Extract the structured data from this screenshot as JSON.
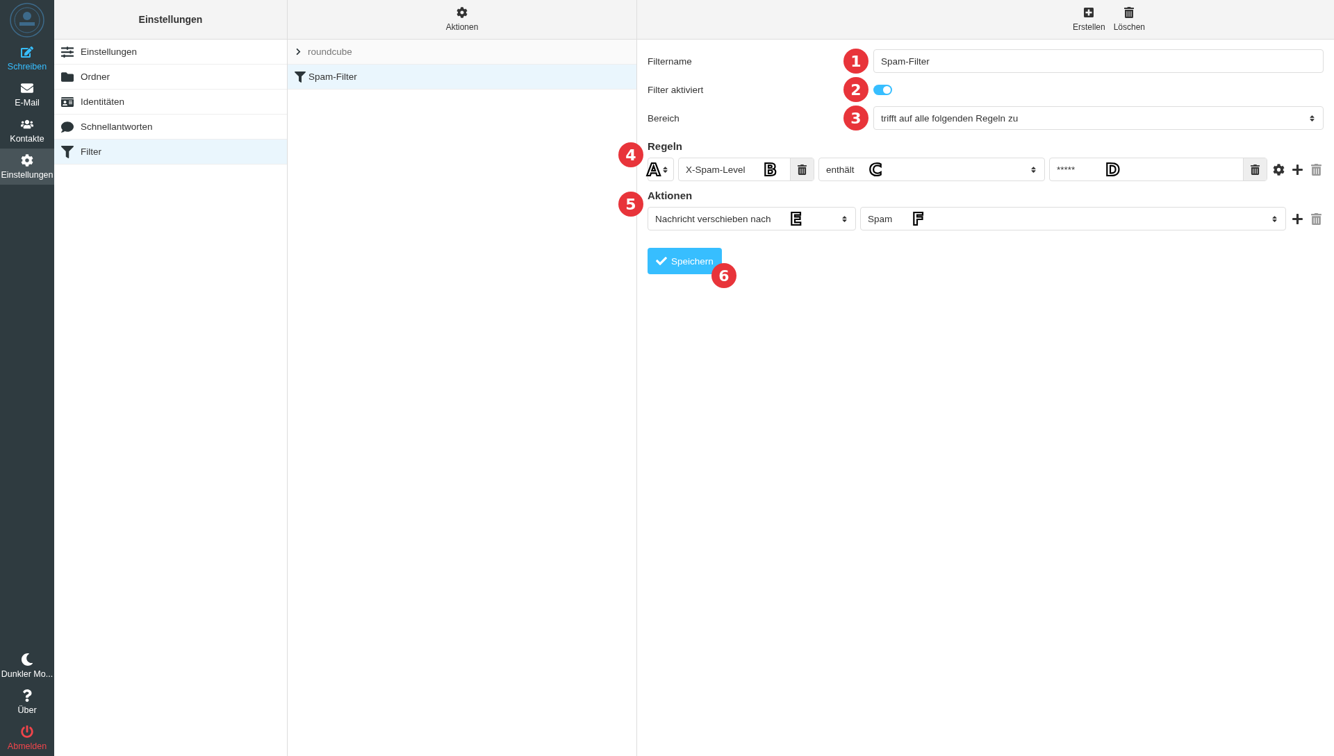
{
  "nav": {
    "items": [
      {
        "kind": "compose",
        "label": "Schreiben",
        "selected": false,
        "accent": true
      },
      {
        "kind": "mail",
        "label": "E-Mail",
        "selected": false,
        "accent": false
      },
      {
        "kind": "contacts",
        "label": "Kontakte",
        "selected": false,
        "accent": false
      },
      {
        "kind": "settings",
        "label": "Einstellungen",
        "selected": true,
        "accent": false
      }
    ],
    "bottom": [
      {
        "kind": "darkmode",
        "label": "Dunkler Mo..."
      },
      {
        "kind": "about",
        "label": "Über"
      },
      {
        "kind": "logout",
        "label": "Abmelden"
      }
    ]
  },
  "settings_panel": {
    "title": "Einstellungen",
    "items": [
      {
        "kind": "prefs",
        "label": "Einstellungen",
        "selected": false
      },
      {
        "kind": "folders",
        "label": "Ordner",
        "selected": false
      },
      {
        "kind": "identities",
        "label": "Identitäten",
        "selected": false
      },
      {
        "kind": "responses",
        "label": "Schnellantworten",
        "selected": false
      },
      {
        "kind": "filter",
        "label": "Filter",
        "selected": true
      }
    ]
  },
  "filter_panel": {
    "toolbar": [
      {
        "kind": "gear",
        "label": "Aktionen"
      }
    ],
    "set": {
      "label": "roundcube",
      "expanded": false
    },
    "filters": [
      {
        "label": "Spam-Filter",
        "selected": true
      }
    ]
  },
  "form": {
    "toolbar": [
      {
        "kind": "create",
        "label": "Erstellen"
      },
      {
        "kind": "delete",
        "label": "Löschen"
      }
    ],
    "name": {
      "label": "Filtername",
      "value": "Spam-Filter",
      "callout": "1"
    },
    "enabled": {
      "label": "Filter aktiviert",
      "on": true,
      "callout": "2"
    },
    "scope": {
      "label": "Bereich",
      "value": "trifft auf alle folgenden Regeln zu",
      "callout": "3"
    },
    "rules": {
      "title": "Regeln",
      "callout": "4",
      "rule": {
        "type_callout": "A",
        "header": "X-Spam-Level",
        "header_callout": "B",
        "operator": "enthält",
        "operator_callout": "C",
        "value": "*****",
        "value_callout": "D"
      }
    },
    "actions": {
      "title": "Aktionen",
      "callout": "5",
      "action": {
        "type": "Nachricht verschieben nach",
        "type_callout": "E",
        "target": "Spam",
        "target_callout": "F"
      }
    },
    "save": {
      "label": "Speichern",
      "callout": "6"
    }
  }
}
